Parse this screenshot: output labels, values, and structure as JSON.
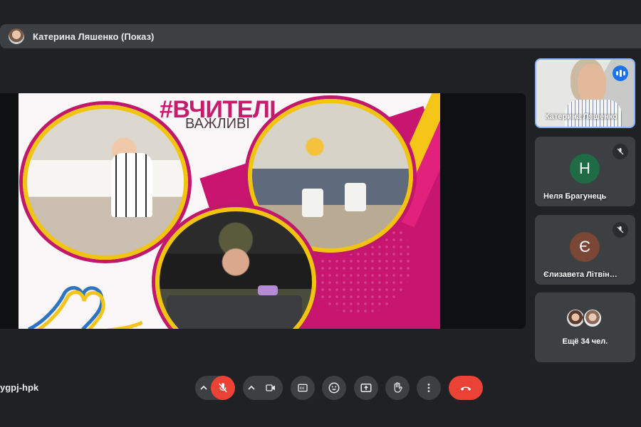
{
  "presenter": {
    "label": "Катерина Ляшенко (Показ)"
  },
  "slide": {
    "title": "#ВЧИТЕЛІ",
    "subtitle": "ВАЖЛИВІ"
  },
  "participants": [
    {
      "name": "Катерина Ляшенко",
      "state": "speaking",
      "video": true
    },
    {
      "name": "Неля Брагунець",
      "initial": "Н",
      "avatar_color": "#1e6b45",
      "muted": true
    },
    {
      "name": "Єлизавета Літвін…",
      "initial": "Є",
      "avatar_color": "#7a4636",
      "muted": true
    }
  ],
  "more": {
    "label": "Ещё 34 чел."
  },
  "meeting_code": "ygpj-hpk",
  "controls": {
    "mic": {
      "icon": "mic-off-icon",
      "state": "off",
      "color": "#ea4335"
    },
    "camera": {
      "icon": "camera-icon"
    },
    "captions": {
      "icon": "captions-icon"
    },
    "reactions": {
      "icon": "emoji-icon"
    },
    "present": {
      "icon": "present-screen-icon"
    },
    "raise_hand": {
      "icon": "hand-icon"
    },
    "more": {
      "icon": "more-vert-icon"
    },
    "end_call": {
      "icon": "call-end-icon",
      "color": "#ea4335"
    }
  },
  "colors": {
    "background": "#202124",
    "surface": "#3c4043",
    "active_border": "#8ab4f8",
    "accent_blue": "#1a73e8",
    "danger": "#ea4335"
  }
}
